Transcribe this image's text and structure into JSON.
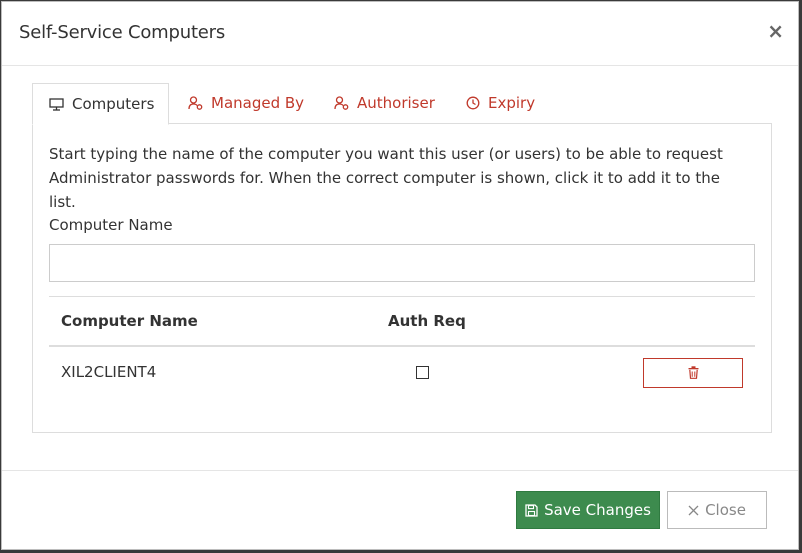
{
  "dialog": {
    "title": "Self-Service Computers",
    "close_glyph": "×"
  },
  "tabs": [
    {
      "label": "Computers",
      "icon": "monitor-icon",
      "active": true
    },
    {
      "label": "Managed By",
      "icon": "users-cog-icon",
      "active": false
    },
    {
      "label": "Authoriser",
      "icon": "user-cog-icon",
      "active": false
    },
    {
      "label": "Expiry",
      "icon": "clock-icon",
      "active": false
    }
  ],
  "computers_tab": {
    "intro": "Start typing the name of the computer you want this user (or users) to be able to request Administrator passwords for. When the correct computer is shown, click it to add it to the list.",
    "field_label": "Computer Name",
    "field_value": "",
    "field_placeholder": "",
    "table": {
      "headers": [
        "Computer Name",
        "Auth Req"
      ],
      "rows": [
        {
          "computer_name": "XIL2CLIENT4",
          "auth_req": false
        }
      ]
    }
  },
  "footer": {
    "save_label": "Save Changes",
    "close_label": "Close"
  },
  "colors": {
    "accent_red": "#c0392b",
    "save_green": "#3d8b4e"
  }
}
